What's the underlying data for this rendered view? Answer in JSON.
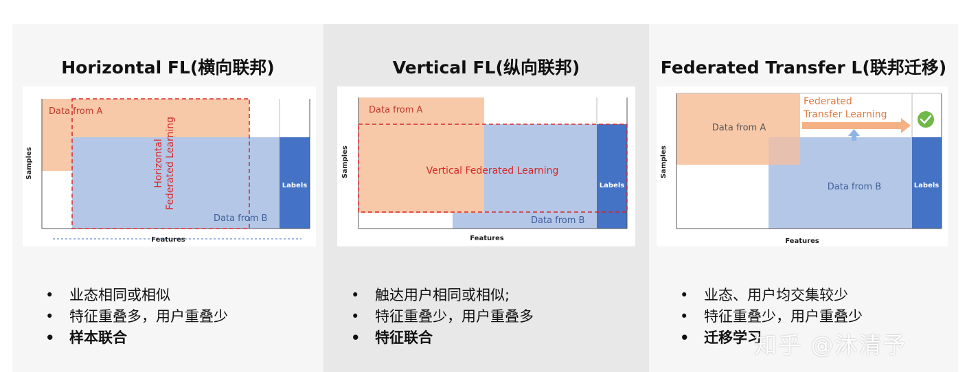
{
  "panels": [
    {
      "title": "Horizontal FL(横向联邦)",
      "diagram": {
        "data_a": "Data from A",
        "data_b": "Data from B",
        "labels": "Labels",
        "samples": "Samples",
        "features": "Features",
        "fl_line1": "Horizontal",
        "fl_line2": "Federated Learning"
      },
      "bullets": [
        "业态相同或相似",
        "特征重叠多，用户重叠少",
        "样本联合"
      ]
    },
    {
      "title": "Vertical FL(纵向联邦)",
      "diagram": {
        "data_a": "Data from A",
        "data_b": "Data from B",
        "labels": "Labels",
        "samples": "Samples",
        "features": "Features",
        "fl_text": "Vertical Federated Learning"
      },
      "bullets": [
        "触达用户相同或相似;",
        "特征重叠少，用户重叠多",
        "特征联合"
      ]
    },
    {
      "title": "Federated Transfer L(联邦迁移)",
      "diagram": {
        "data_a": "Data from A",
        "data_b": "Data from B",
        "labels": "Labels",
        "samples": "Samples",
        "features": "Features",
        "ftl_line1": "Federated",
        "ftl_line2": "Transfer Learning"
      },
      "bullets": [
        "业态、用户均交集较少",
        "特征重叠少，用户重叠少",
        "迁移学习"
      ]
    }
  ],
  "bullet_symbol": "•",
  "watermark": "知乎 @沐清予",
  "colors": {
    "data_a": "#f7c9a9",
    "data_b": "#b4c7e7",
    "labels": "#4472c4",
    "dashed": "#d62828",
    "check": "#70b84a",
    "arrow": "#f4b183"
  }
}
